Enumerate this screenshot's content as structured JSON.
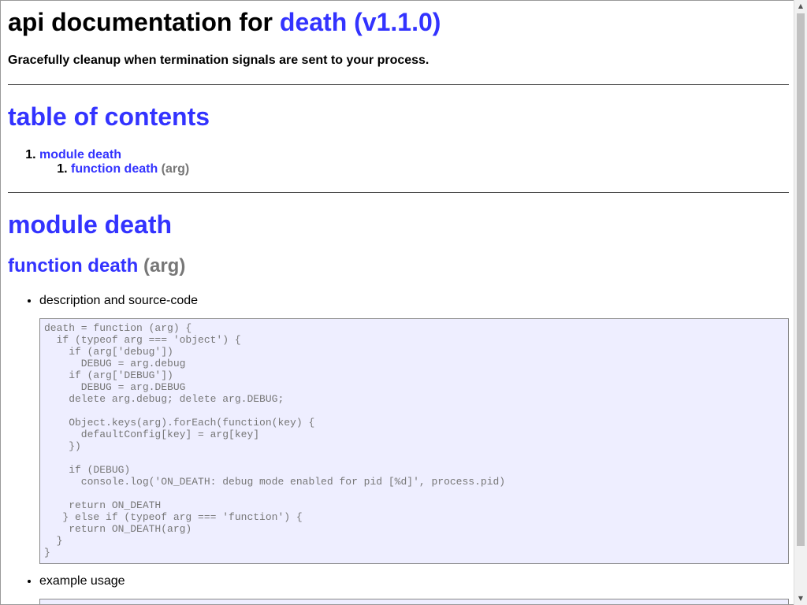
{
  "header": {
    "title_prefix": "api documentation for ",
    "title_link": "death (v1.1.0)",
    "description": "Gracefully cleanup when termination signals are sent to your process."
  },
  "toc": {
    "heading": "table of contents",
    "module_link": "module death",
    "function_link": "function death",
    "function_args": "(arg)"
  },
  "module": {
    "heading": "module death",
    "function_name": "function death",
    "function_args": "(arg)"
  },
  "sections": {
    "description_label": "description and source-code",
    "example_label": "example usage"
  },
  "source_code": "death = function (arg) {\n  if (typeof arg === 'object') {\n    if (arg['debug'])\n      DEBUG = arg.debug\n    if (arg['DEBUG'])\n      DEBUG = arg.DEBUG\n    delete arg.debug; delete arg.DEBUG;\n\n    Object.keys(arg).forEach(function(key) {\n      defaultConfig[key] = arg[key]\n    })\n\n    if (DEBUG)\n      console.log('ON_DEATH: debug mode enabled for pid [%d]', process.pid)\n\n    return ON_DEATH\n   } else if (typeof arg === 'function') {\n    return ON_DEATH(arg)\n  }\n}",
  "colors": {
    "link": "#3333ff",
    "muted": "#777777",
    "code_bg": "#eeeeff"
  }
}
